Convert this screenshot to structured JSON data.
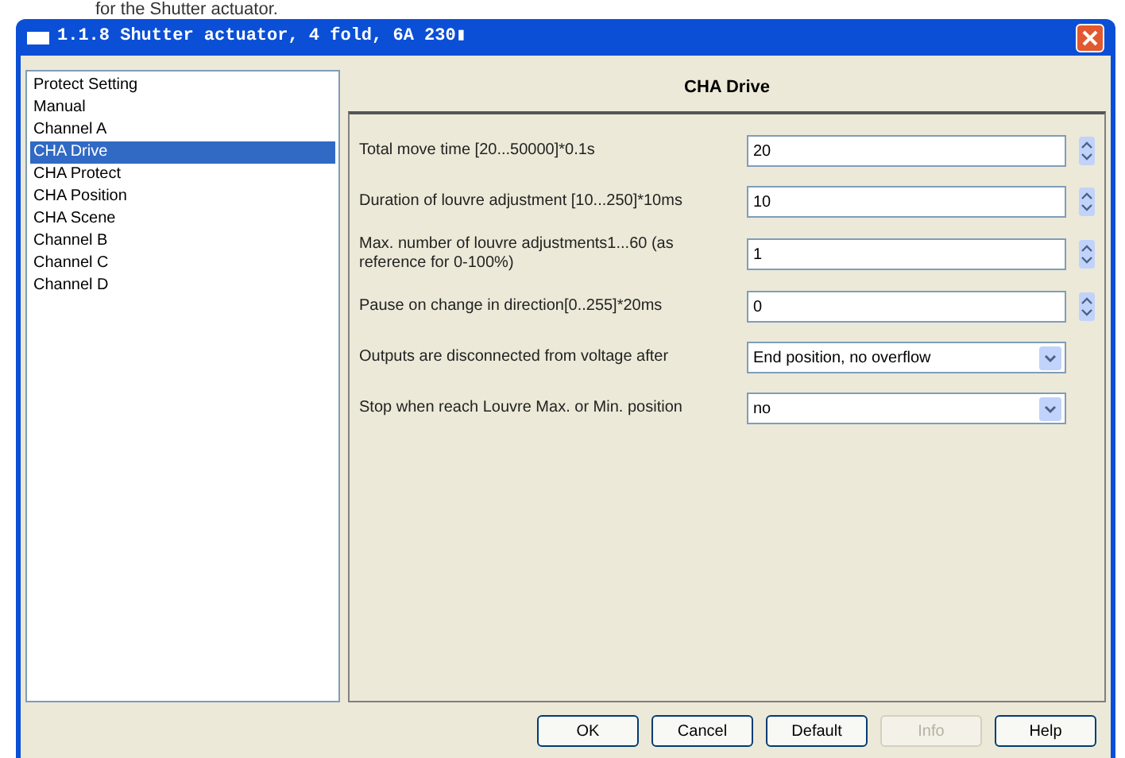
{
  "document_text": "for the Shutter actuator.",
  "window": {
    "title": "1.1.8 Shutter actuator, 4 fold, 6A 230▮"
  },
  "sidebar": {
    "items": [
      {
        "label": "Protect Setting",
        "selected": false
      },
      {
        "label": "Manual",
        "selected": false
      },
      {
        "label": "Channel A",
        "selected": false
      },
      {
        "label": "CHA Drive",
        "selected": true
      },
      {
        "label": "CHA Protect",
        "selected": false
      },
      {
        "label": "CHA Position",
        "selected": false
      },
      {
        "label": "CHA Scene",
        "selected": false
      },
      {
        "label": "Channel B",
        "selected": false
      },
      {
        "label": "Channel C",
        "selected": false
      },
      {
        "label": "Channel D",
        "selected": false
      }
    ]
  },
  "panel": {
    "title": "CHA Drive",
    "parameters": [
      {
        "label": "Total move time [20...50000]*0.1s",
        "kind": "spinner",
        "value": "20"
      },
      {
        "label": "Duration of louvre adjustment [10...250]*10ms",
        "kind": "spinner",
        "value": "10"
      },
      {
        "label": "Max. number of louvre adjustments1...60 (as reference for 0-100%)",
        "kind": "spinner",
        "value": "1"
      },
      {
        "label": "Pause on change in direction[0..255]*20ms",
        "kind": "spinner",
        "value": "0"
      },
      {
        "label": "Outputs are disconnected from voltage after",
        "kind": "dropdown",
        "value": "End position, no overflow"
      },
      {
        "label": "Stop when reach Louvre Max. or Min. position",
        "kind": "dropdown",
        "value": "no"
      }
    ]
  },
  "buttons": [
    {
      "label": "OK",
      "disabled": false
    },
    {
      "label": "Cancel",
      "disabled": false
    },
    {
      "label": "Default",
      "disabled": false
    },
    {
      "label": "Info",
      "disabled": true
    },
    {
      "label": "Help",
      "disabled": false
    }
  ]
}
